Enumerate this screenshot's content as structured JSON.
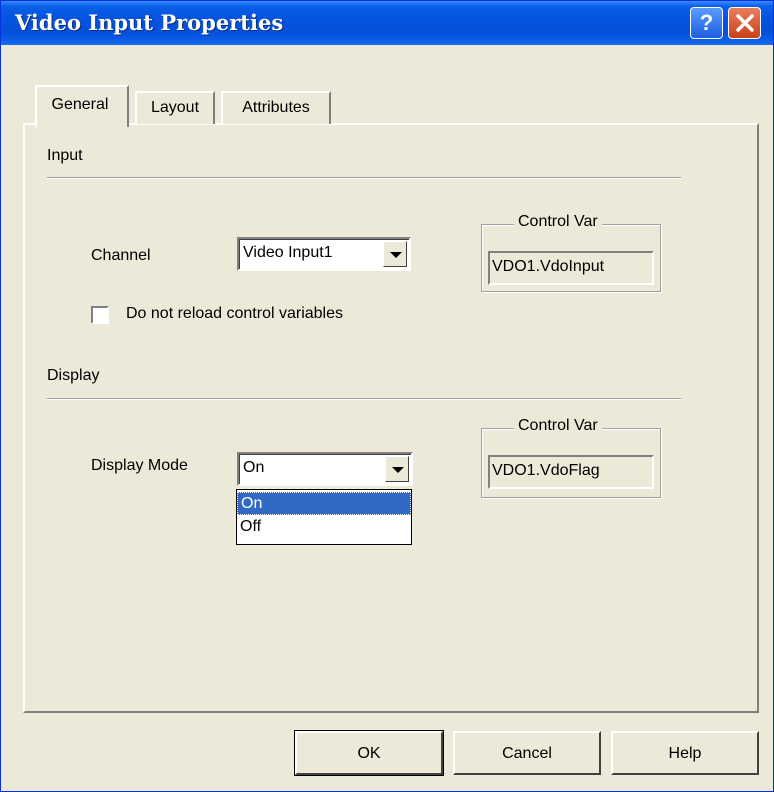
{
  "window": {
    "title": "Video Input Properties",
    "help_button": "?",
    "close_button_icon": "close-icon"
  },
  "tabs": [
    {
      "label": "General",
      "active": true
    },
    {
      "label": "Layout",
      "active": false
    },
    {
      "label": "Attributes",
      "active": false
    }
  ],
  "input_section": {
    "heading": "Input",
    "channel_label": "Channel",
    "channel_value": "Video Input1",
    "control_var_title": "Control Var",
    "control_var_value": "VDO1.VdoInput",
    "checkbox_label": "Do not reload control variables",
    "checkbox_checked": false
  },
  "display_section": {
    "heading": "Display",
    "mode_label": "Display Mode",
    "mode_value": "On",
    "mode_options": [
      "On",
      "Off"
    ],
    "selected_option": "On",
    "control_var_title": "Control Var",
    "control_var_value": "VDO1.VdoFlag"
  },
  "buttons": {
    "ok": "OK",
    "cancel": "Cancel",
    "help": "Help"
  },
  "colors": {
    "titlebar": "#0553e0",
    "dialog_bg": "#ece9d8",
    "selection": "#316ac5",
    "close_button": "#c9401a"
  }
}
